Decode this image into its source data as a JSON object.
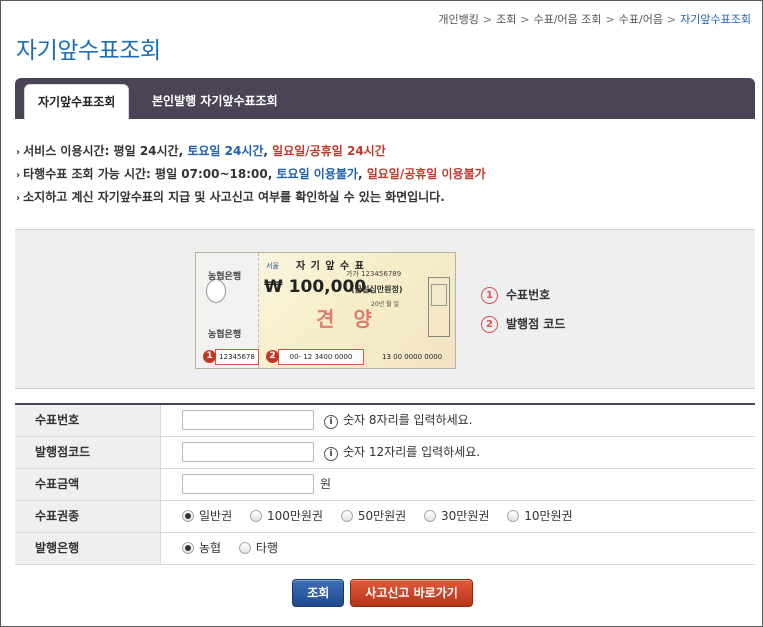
{
  "breadcrumb": {
    "items": [
      "개인뱅킹",
      "조회",
      "수표/어음 조회",
      "수표/어음"
    ],
    "current": "자기앞수표조회"
  },
  "page_title": "자기앞수표조회",
  "tabs": [
    {
      "label": "자기앞수표조회",
      "active": true
    },
    {
      "label": "본인발행 자기앞수표조회",
      "active": false
    }
  ],
  "notices": {
    "line1": {
      "a": "서비스 이용시간: 평일 24시간, ",
      "b": "토요일 24시간",
      "c": ", ",
      "d": "일요일/공휴일 24시간"
    },
    "line2": {
      "a": "타행수표 조회 가능 시간: 평일 07:00~18:00, ",
      "b": "토요일 이용불가",
      "c": ", ",
      "d": "일요일/공휴일 이용불가"
    },
    "line3": "소지하고 계신 자기앞수표의 지급 및 사고신고 여부를 확인하실 수 있는 화면입니다."
  },
  "sample_cheque": {
    "title": "자 기 앞 수 표",
    "region": "서울",
    "serial_top": "가가 123456789",
    "amount": "₩ 100,000.",
    "amount_korean": "(금일십만원정)",
    "bank_name": "농협은행",
    "stamp": "견 양",
    "date": "20년 월 일",
    "box1": "12345678",
    "box2": "00- 12 3400 0000",
    "micr": "13 00 0000 0000",
    "marker1": "1",
    "marker2": "2"
  },
  "legend": [
    {
      "num": "1",
      "label": "수표번호"
    },
    {
      "num": "2",
      "label": "발행점 코드"
    }
  ],
  "form": {
    "cheque_number": {
      "label": "수표번호",
      "value": "",
      "hint": "숫자 8자리를 입력하세요."
    },
    "branch_code": {
      "label": "발행점코드",
      "value": "",
      "hint": "숫자 12자리를 입력하세요."
    },
    "amount": {
      "label": "수표금액",
      "value": "",
      "unit": "원"
    },
    "denomination": {
      "label": "수표권종",
      "options": [
        "일반권",
        "100만원권",
        "50만원권",
        "30만원권",
        "10만원권"
      ],
      "selected": "일반권"
    },
    "issuing_bank": {
      "label": "발행은행",
      "options": [
        "농협",
        "타행"
      ],
      "selected": "농협"
    },
    "info_icon": "i"
  },
  "buttons": {
    "query": "조회",
    "report": "사고신고 바로가기"
  }
}
